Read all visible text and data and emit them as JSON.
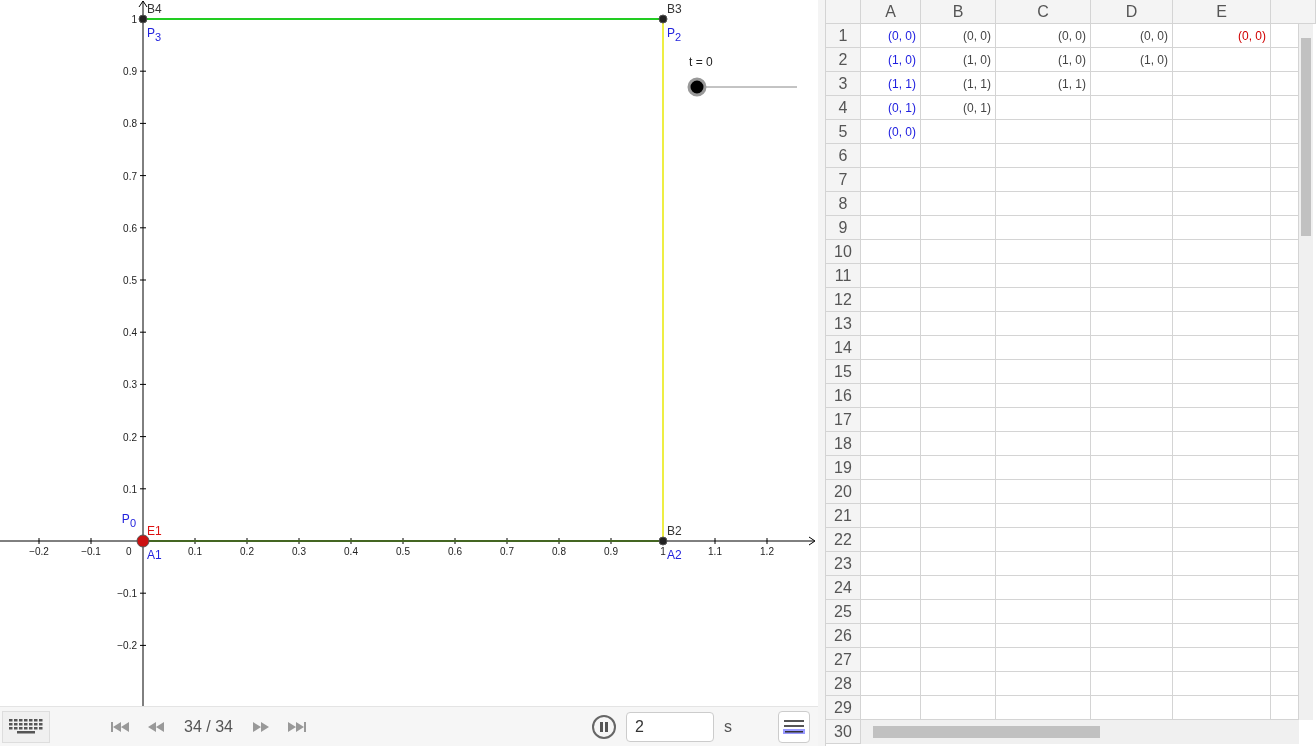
{
  "graphics": {
    "x_ticks": [
      "−0.2",
      "−0.1",
      "0.1",
      "0.2",
      "0.3",
      "0.4",
      "0.5",
      "0.6",
      "0.7",
      "0.8",
      "0.9",
      "1",
      "1.1",
      "1.2"
    ],
    "y_ticks": [
      "1",
      "0.9",
      "0.8",
      "0.7",
      "0.6",
      "0.5",
      "0.4",
      "0.3",
      "0.2",
      "0.1",
      "−0.1",
      "−0.2"
    ],
    "origin_label": "0",
    "segments": [
      {
        "color": "#22cc22"
      },
      {
        "color": "#446622"
      },
      {
        "color": "#eeee44"
      }
    ],
    "points": [
      {
        "color": "#cc1111",
        "large": true
      },
      {
        "color": "#222222",
        "large": false
      },
      {
        "color": "#222222",
        "large": false
      },
      {
        "color": "#222222",
        "large": false
      }
    ],
    "labels": [
      {
        "text": "B4",
        "color": "#333333"
      },
      {
        "text": "P3",
        "color": "#2222dd"
      },
      {
        "text": "B3",
        "color": "#333333"
      },
      {
        "text": "P2",
        "color": "#2222dd"
      },
      {
        "text": "P0",
        "color": "#2222dd"
      },
      {
        "text": "E1",
        "color": "#dd1111"
      },
      {
        "text": "A1",
        "color": "#2222dd"
      },
      {
        "text": "B2",
        "color": "#333333"
      },
      {
        "text": "A2",
        "color": "#2222dd"
      }
    ],
    "slider": {
      "label": "t = 0",
      "level": 0
    }
  },
  "playback": {
    "counter": "34 / 34",
    "playing": true,
    "step": "2",
    "unit": "s"
  },
  "spreadsheet": {
    "columns": [
      "A",
      "B",
      "C",
      "D",
      "E"
    ],
    "row_numbers": [
      "1",
      "2",
      "3",
      "4",
      "5",
      "6",
      "7",
      "8",
      "9",
      "10",
      "11",
      "12",
      "13",
      "14",
      "15",
      "16",
      "17",
      "18",
      "19",
      "20",
      "21",
      "22",
      "23",
      "24",
      "25",
      "26",
      "27",
      "28",
      "29",
      "30"
    ],
    "rows": [
      {
        "cells": [
          {
            "text": "(0, 0)",
            "color": "#2020e0"
          },
          {
            "text": "(0, 0)",
            "color": "#444444"
          },
          {
            "text": "(0, 0)",
            "color": "#444444"
          },
          {
            "text": "(0, 0)",
            "color": "#444444"
          },
          {
            "text": "(0, 0)",
            "color": "#d00000"
          }
        ]
      },
      {
        "cells": [
          {
            "text": "(1, 0)",
            "color": "#2020e0"
          },
          {
            "text": "(1, 0)",
            "color": "#444444"
          },
          {
            "text": "(1, 0)",
            "color": "#444444"
          },
          {
            "text": "(1, 0)",
            "color": "#444444"
          }
        ]
      },
      {
        "cells": [
          {
            "text": "(1, 1)",
            "color": "#2020e0"
          },
          {
            "text": "(1, 1)",
            "color": "#444444"
          },
          {
            "text": "(1, 1)",
            "color": "#444444"
          }
        ]
      },
      {
        "cells": [
          {
            "text": "(0, 1)",
            "color": "#2020e0"
          },
          {
            "text": "(0, 1)",
            "color": "#444444"
          }
        ]
      },
      {
        "cells": [
          {
            "text": "(0, 0)",
            "color": "#2020e0"
          }
        ]
      }
    ]
  }
}
